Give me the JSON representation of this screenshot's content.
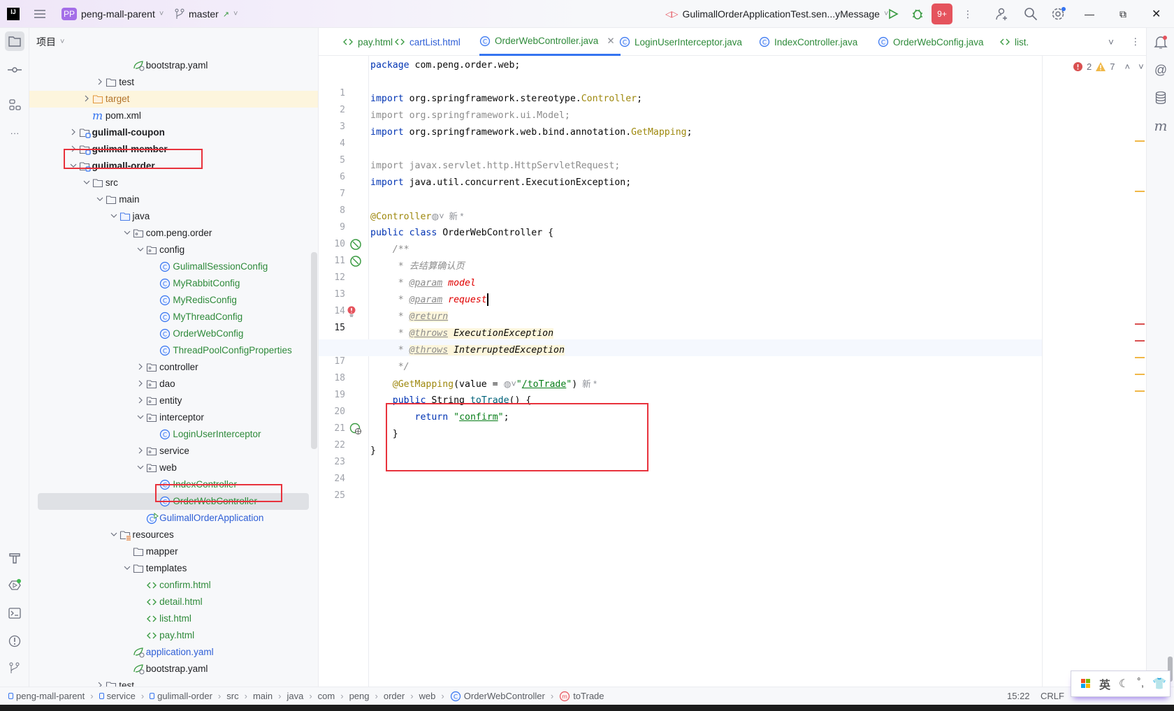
{
  "titlebar": {
    "logo": "IJ",
    "project_badge": "PP",
    "project_name": "peng-mall-parent",
    "branch": "master",
    "run_config": "GulimallOrderApplicationTest.sen...yMessage",
    "notification_badge": "9+",
    "colors": {
      "badge": "#a46ee8",
      "run": "#3a9b42",
      "alert": "#e5535d"
    }
  },
  "project_panel": {
    "title": "项目",
    "tree": [
      {
        "level": 4,
        "label": "bootstrap.yaml",
        "icon": "yaml-icon",
        "arrow": "none",
        "color": ""
      },
      {
        "level": 2,
        "label": "test",
        "icon": "folder-icon",
        "arrow": "collapsed",
        "color": ""
      },
      {
        "level": 1,
        "label": "target",
        "icon": "folder-orange-icon",
        "arrow": "collapsed",
        "color": "orange",
        "highlight": true
      },
      {
        "level": 1,
        "label": "pom.xml",
        "icon": "maven-icon",
        "arrow": "none",
        "color": ""
      },
      {
        "level": 0,
        "label": "gulimall-coupon",
        "icon": "module-icon",
        "arrow": "collapsed",
        "bold": true
      },
      {
        "level": 0,
        "label": "gulimall-member",
        "icon": "module-icon",
        "arrow": "collapsed",
        "bold": true
      },
      {
        "level": 0,
        "label": "gulimall-order",
        "icon": "module-icon",
        "arrow": "expanded",
        "bold": true,
        "boxed": true
      },
      {
        "level": 1,
        "label": "src",
        "icon": "folder-icon",
        "arrow": "expanded"
      },
      {
        "level": 2,
        "label": "main",
        "icon": "folder-icon",
        "arrow": "expanded"
      },
      {
        "level": 3,
        "label": "java",
        "icon": "folder-blue-icon",
        "arrow": "expanded"
      },
      {
        "level": 4,
        "label": "com.peng.order",
        "icon": "package-icon",
        "arrow": "expanded"
      },
      {
        "level": 5,
        "label": "config",
        "icon": "package-icon",
        "arrow": "expanded"
      },
      {
        "level": 6,
        "label": "GulimallSessionConfig",
        "icon": "class-icon",
        "arrow": "none",
        "color": "green"
      },
      {
        "level": 6,
        "label": "MyRabbitConfig",
        "icon": "class-icon",
        "arrow": "none",
        "color": "green"
      },
      {
        "level": 6,
        "label": "MyRedisConfig",
        "icon": "class-icon",
        "arrow": "none",
        "color": "green"
      },
      {
        "level": 6,
        "label": "MyThreadConfig",
        "icon": "class-icon",
        "arrow": "none",
        "color": "green"
      },
      {
        "level": 6,
        "label": "OrderWebConfig",
        "icon": "class-icon",
        "arrow": "none",
        "color": "green"
      },
      {
        "level": 6,
        "label": "ThreadPoolConfigProperties",
        "icon": "class-icon",
        "arrow": "none",
        "color": "green"
      },
      {
        "level": 5,
        "label": "controller",
        "icon": "package-icon",
        "arrow": "collapsed"
      },
      {
        "level": 5,
        "label": "dao",
        "icon": "package-icon",
        "arrow": "collapsed"
      },
      {
        "level": 5,
        "label": "entity",
        "icon": "package-icon",
        "arrow": "collapsed"
      },
      {
        "level": 5,
        "label": "interceptor",
        "icon": "package-icon",
        "arrow": "expanded"
      },
      {
        "level": 6,
        "label": "LoginUserInterceptor",
        "icon": "class-icon",
        "arrow": "none",
        "color": "green"
      },
      {
        "level": 5,
        "label": "service",
        "icon": "package-icon",
        "arrow": "collapsed"
      },
      {
        "level": 5,
        "label": "web",
        "icon": "package-icon",
        "arrow": "expanded"
      },
      {
        "level": 6,
        "label": "IndexController",
        "icon": "class-icon",
        "arrow": "none",
        "color": "green"
      },
      {
        "level": 6,
        "label": "OrderWebController",
        "icon": "class-icon",
        "arrow": "none",
        "color": "green",
        "selected": true,
        "boxed": true
      },
      {
        "level": 5,
        "label": "GulimallOrderApplication",
        "icon": "spring-app-icon",
        "arrow": "none",
        "color": "blue"
      },
      {
        "level": 3,
        "label": "resources",
        "icon": "resources-folder-icon",
        "arrow": "expanded"
      },
      {
        "level": 4,
        "label": "mapper",
        "icon": "folder-icon",
        "arrow": "none"
      },
      {
        "level": 4,
        "label": "templates",
        "icon": "folder-icon",
        "arrow": "expanded"
      },
      {
        "level": 5,
        "label": "confirm.html",
        "icon": "html-icon",
        "arrow": "none",
        "color": "green"
      },
      {
        "level": 5,
        "label": "detail.html",
        "icon": "html-icon",
        "arrow": "none",
        "color": "green"
      },
      {
        "level": 5,
        "label": "list.html",
        "icon": "html-icon",
        "arrow": "none",
        "color": "green"
      },
      {
        "level": 5,
        "label": "pay.html",
        "icon": "html-icon",
        "arrow": "none",
        "color": "green"
      },
      {
        "level": 4,
        "label": "application.yaml",
        "icon": "yaml-icon",
        "arrow": "none",
        "color": "blue"
      },
      {
        "level": 4,
        "label": "bootstrap.yaml",
        "icon": "yaml-icon",
        "arrow": "none"
      },
      {
        "level": 2,
        "label": "test",
        "icon": "folder-icon",
        "arrow": "collapsed"
      }
    ]
  },
  "editor": {
    "tabs": [
      {
        "label": "pay.html",
        "icon": "html-icon",
        "color": "green"
      },
      {
        "label": "cartList.html",
        "icon": "html-icon",
        "color": "blue"
      },
      {
        "label": "OrderWebController.java",
        "icon": "class-icon",
        "color": "green",
        "active": true
      },
      {
        "label": "LoginUserInterceptor.java",
        "icon": "class-icon",
        "color": "green"
      },
      {
        "label": "IndexController.java",
        "icon": "class-icon",
        "color": "green"
      },
      {
        "label": "OrderWebConfig.java",
        "icon": "class-icon",
        "color": "green"
      },
      {
        "label": "list.",
        "icon": "html-icon",
        "color": "green"
      }
    ],
    "inspections": {
      "errors": "2",
      "warnings": "7"
    },
    "current_line": 15,
    "lines": [
      [
        {
          "t": "package",
          "c": "kw"
        },
        {
          "t": " com.peng.order.web;"
        }
      ],
      [],
      [
        {
          "t": "import",
          "c": "kw"
        },
        {
          "t": " org.springframework.stereotype."
        },
        {
          "t": "Controller",
          "c": "ann"
        },
        {
          "t": ";"
        }
      ],
      [
        {
          "t": "import org.springframework.ui.Model;",
          "c": "grey"
        }
      ],
      [
        {
          "t": "import",
          "c": "kw"
        },
        {
          "t": " org.springframework.web.bind.annotation."
        },
        {
          "t": "GetMapping",
          "c": "ann"
        },
        {
          "t": ";"
        }
      ],
      [],
      [
        {
          "t": "import javax.servlet.http.HttpServletRequest;",
          "c": "grey"
        }
      ],
      [
        {
          "t": "import",
          "c": "kw"
        },
        {
          "t": " java.util.concurrent.ExecutionException;"
        }
      ],
      [],
      [
        {
          "t": "@Controller",
          "c": "ann"
        },
        {
          "t": "◍˅",
          "c": "inlay"
        },
        {
          "t": "  新 *",
          "c": "inlay"
        }
      ],
      [
        {
          "t": "public class",
          "c": "kw"
        },
        {
          "t": " OrderWebController {"
        }
      ],
      [
        {
          "t": "    /**",
          "c": "cmt"
        }
      ],
      [
        {
          "t": "     * 去结算确认页",
          "c": "cmt"
        }
      ],
      [
        {
          "t": "     * ",
          "c": "cmt"
        },
        {
          "t": "@param",
          "c": "doctag"
        },
        {
          "t": " "
        },
        {
          "t": "model",
          "c": "docred"
        }
      ],
      [
        {
          "t": "     * ",
          "c": "cmt"
        },
        {
          "t": "@param",
          "c": "doctag"
        },
        {
          "t": " "
        },
        {
          "t": "request",
          "c": "docred"
        },
        {
          "t": "",
          "c": "caret"
        }
      ],
      [
        {
          "t": "     * ",
          "c": "cmt"
        },
        {
          "t": "@return",
          "c": "doctag hl"
        }
      ],
      [
        {
          "t": "     * ",
          "c": "cmt"
        },
        {
          "t": "@throws",
          "c": "doctag hl"
        },
        {
          "t": " ",
          "c": "hl"
        },
        {
          "t": "ExecutionException",
          "c": "docref"
        }
      ],
      [
        {
          "t": "     * ",
          "c": "cmt"
        },
        {
          "t": "@throws",
          "c": "doctag hl"
        },
        {
          "t": " ",
          "c": "hl"
        },
        {
          "t": "InterruptedException",
          "c": "docref"
        }
      ],
      [
        {
          "t": "     */",
          "c": "cmt"
        }
      ],
      [
        {
          "t": "    "
        },
        {
          "t": "@GetMapping",
          "c": "ann"
        },
        {
          "t": "(value = "
        },
        {
          "t": "◍˅",
          "c": "inlay"
        },
        {
          "t": "\"",
          "c": "str"
        },
        {
          "t": "/toTrade",
          "c": "str u"
        },
        {
          "t": "\"",
          "c": "str"
        },
        {
          "t": ")"
        },
        {
          "t": "  新 *",
          "c": "inlay"
        }
      ],
      [
        {
          "t": "    "
        },
        {
          "t": "public",
          "c": "kw"
        },
        {
          "t": " String "
        },
        {
          "t": "toTrade",
          "c": "method"
        },
        {
          "t": "() {"
        }
      ],
      [
        {
          "t": "        "
        },
        {
          "t": "return",
          "c": "kw"
        },
        {
          "t": " "
        },
        {
          "t": "\"",
          "c": "str"
        },
        {
          "t": "confirm",
          "c": "str u"
        },
        {
          "t": "\"",
          "c": "str"
        },
        {
          "t": ";"
        }
      ],
      [
        {
          "t": "    }"
        }
      ],
      [
        {
          "t": "}"
        }
      ],
      []
    ],
    "gutter_icons": [
      {
        "line": 10,
        "icon": "spring-bean-icon"
      },
      {
        "line": 11,
        "icon": "spring-bean-icon"
      },
      {
        "line": 14,
        "icon": "error-bulb-icon"
      },
      {
        "line": 21,
        "icon": "web-endpoint-icon"
      }
    ],
    "marker_colors": {
      "error": "#d95050",
      "warning": "#f0b848"
    }
  },
  "statusbar": {
    "breadcrumbs": [
      "peng-mall-parent",
      "service",
      "gulimall-order",
      "src",
      "main",
      "java",
      "com",
      "peng",
      "order",
      "web",
      "OrderWebController",
      "toTrade"
    ],
    "position": "15:22",
    "line_ending": "CRLF"
  },
  "ime": {
    "mode": "英"
  }
}
